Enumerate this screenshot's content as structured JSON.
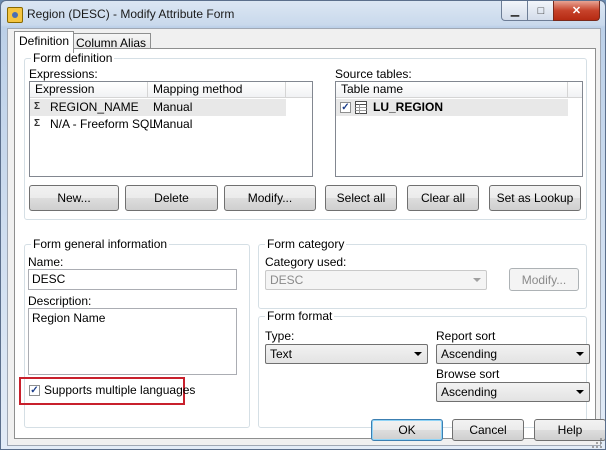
{
  "window": {
    "title": "Region (DESC) - Modify Attribute Form",
    "icons": {
      "app": "app-icon",
      "minimize": "minimize-icon",
      "maximize": "maximize-icon",
      "close": "close-icon"
    },
    "min_glyph": "▁",
    "max_glyph": "□",
    "close_glyph": "✕"
  },
  "tabs": [
    {
      "label": "Definition",
      "active": true
    },
    {
      "label": "Column Alias",
      "active": false
    }
  ],
  "form_definition": {
    "title": "Form definition",
    "expressions_label": "Expressions:",
    "columns": [
      "Expression",
      "Mapping method"
    ],
    "rows": [
      {
        "expression": "REGION_NAME",
        "mapping": "Manual",
        "icon": "expression-icon"
      },
      {
        "expression": "N/A - Freeform SQL",
        "mapping": "Manual",
        "icon": "expression-icon"
      }
    ],
    "source_tables_label": "Source tables:",
    "source_columns": [
      "Table name"
    ],
    "source_rows": [
      {
        "name": "LU_REGION",
        "checked": true,
        "icon": "table-icon"
      }
    ],
    "buttons": {
      "new": "New...",
      "delete": "Delete",
      "modify": "Modify...",
      "select_all": "Select all",
      "clear_all": "Clear all",
      "set_as_lookup": "Set as Lookup"
    }
  },
  "form_general": {
    "title": "Form general information",
    "name_label": "Name:",
    "name_value": "DESC",
    "description_label": "Description:",
    "description_value": "Region Name",
    "supports_multiple_languages": {
      "label": "Supports multiple languages",
      "checked": true
    }
  },
  "form_category": {
    "title": "Form category",
    "category_used_label": "Category used:",
    "category_used_value": "DESC",
    "modify_button": "Modify..."
  },
  "form_format": {
    "title": "Form format",
    "type_label": "Type:",
    "type_value": "Text",
    "report_sort_label": "Report sort",
    "report_sort_value": "Ascending",
    "browse_sort_label": "Browse sort",
    "browse_sort_value": "Ascending"
  },
  "footer": {
    "ok": "OK",
    "cancel": "Cancel",
    "help": "Help"
  },
  "colors": {
    "highlight": "#c8202c",
    "selection": "#e8e8e8"
  },
  "check_glyph": "✓"
}
